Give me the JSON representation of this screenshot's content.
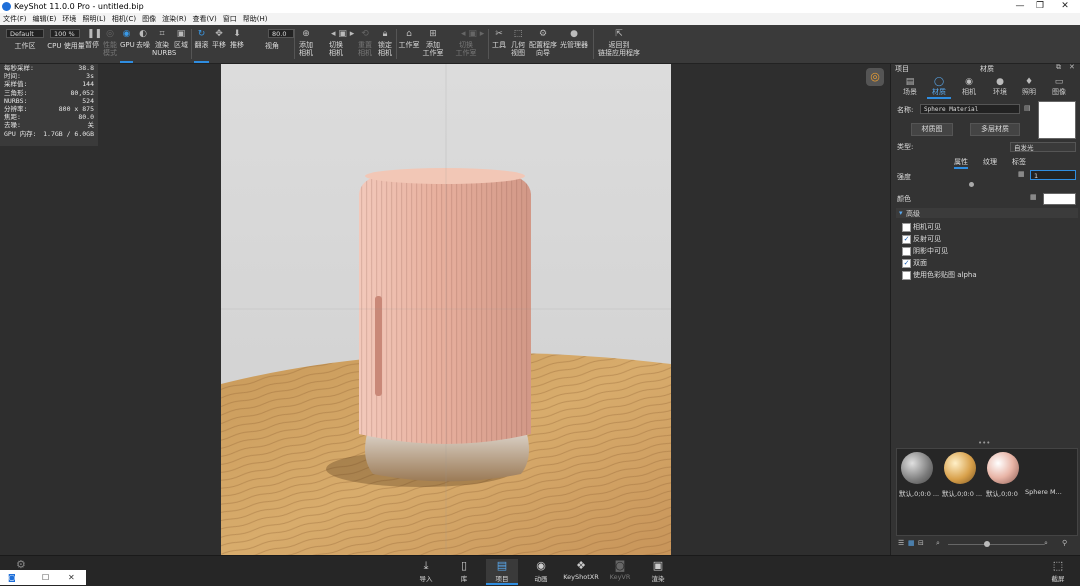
{
  "window": {
    "title": "KeyShot 11.0.0 Pro - untitled.bip",
    "minimize": "—",
    "restore": "❐",
    "close": "✕"
  },
  "menu": [
    "文件(F)",
    "编辑(E)",
    "环境",
    "照明(L)",
    "相机(C)",
    "图像",
    "渲染(R)",
    "查看(V)",
    "窗口",
    "帮助(H)"
  ],
  "toolbar": {
    "workspace_value": "Default",
    "workspace_label": "工作区",
    "cpu_percent": "100 %",
    "cpu_label": "CPU 使用量",
    "pause": "暂停",
    "perf_mode": "性能\n模式",
    "gpu": "GPU",
    "denoise": "去噪",
    "render_nurbs": "渲染\nNURBS",
    "region": "区域",
    "tumble": "翻滚",
    "pan": "平移",
    "dolly": "推移",
    "fov_value": "80.0",
    "fov_label": "视角",
    "add_camera": "添加\n相机",
    "switch_camera": "切换\n相机",
    "reset_camera": "重置\n相机",
    "lock_camera": "锁定\n相机",
    "studio": "工作室",
    "add_studio": "添加\n工作室",
    "switch_studio": "切换\n工作室",
    "tools": "工具",
    "geometry_view": "几何\n视图",
    "config_wizard": "配置程序\n向导",
    "light_manager": "光管理器",
    "back_link": "返回到\n链接应用程序"
  },
  "stats": [
    {
      "k": "每秒采样:",
      "v": "38.8"
    },
    {
      "k": "时间:",
      "v": "3s"
    },
    {
      "k": "采样值:",
      "v": "144"
    },
    {
      "k": "三角形:",
      "v": "80,052"
    },
    {
      "k": "NURBS:",
      "v": "524"
    },
    {
      "k": "分辨率:",
      "v": "800 x 875"
    },
    {
      "k": "焦距:",
      "v": "80.0"
    },
    {
      "k": "去噪:",
      "v": "关"
    },
    {
      "k": "GPU 内存:",
      "v": "1.7GB / 6.0GB"
    }
  ],
  "panel": {
    "header_left": "项目",
    "header_title": "材质",
    "tabs": [
      {
        "label": "场景",
        "icon": "scene-icon"
      },
      {
        "label": "材质",
        "icon": "material-icon"
      },
      {
        "label": "相机",
        "icon": "camera-icon"
      },
      {
        "label": "环境",
        "icon": "environment-icon"
      },
      {
        "label": "照明",
        "icon": "lighting-icon"
      },
      {
        "label": "图像",
        "icon": "image-icon"
      }
    ],
    "name_label": "名称:",
    "name_value": "Sphere Material",
    "material_graph": "材质图",
    "multi_layer": "多层材质",
    "type_label": "类型:",
    "type_value": "自发光",
    "subtabs": [
      "属性",
      "纹理",
      "标签"
    ],
    "intensity_label": "强度",
    "intensity_value": "1",
    "color_label": "颜色",
    "advanced_label": "高级",
    "checkboxes": [
      {
        "label": "相机可见",
        "checked": false
      },
      {
        "label": "反射可见",
        "checked": true
      },
      {
        "label": "阴影中可见",
        "checked": false
      },
      {
        "label": "双面",
        "checked": true
      },
      {
        "label": "使用色彩贴图 alpha",
        "checked": false
      }
    ],
    "dots": "•••",
    "thumbnails": [
      {
        "label": "默认,0;0:0 ...",
        "color": "#9a9a9a"
      },
      {
        "label": "默认,0;0:0 ...",
        "color": "#d8a04a"
      },
      {
        "label": "默认,0;0:0",
        "color": "#e8b4a6"
      },
      {
        "label": "Sphere M...",
        "color": "#1e1e1e"
      }
    ]
  },
  "bottom": [
    {
      "label": "导入",
      "icon": "import-icon"
    },
    {
      "label": "库",
      "icon": "library-icon"
    },
    {
      "label": "项目",
      "icon": "project-icon"
    },
    {
      "label": "动画",
      "icon": "animation-icon"
    },
    {
      "label": "KeyShotXR",
      "icon": "keyshotxr-icon"
    },
    {
      "label": "KeyVR",
      "icon": "keyvr-icon"
    },
    {
      "label": "渲染",
      "icon": "render-icon"
    }
  ],
  "screenshot_label": "截屏",
  "colors": {
    "accent": "#2f8de0",
    "object": "#e8b4a6",
    "table": "#c89a5c"
  }
}
